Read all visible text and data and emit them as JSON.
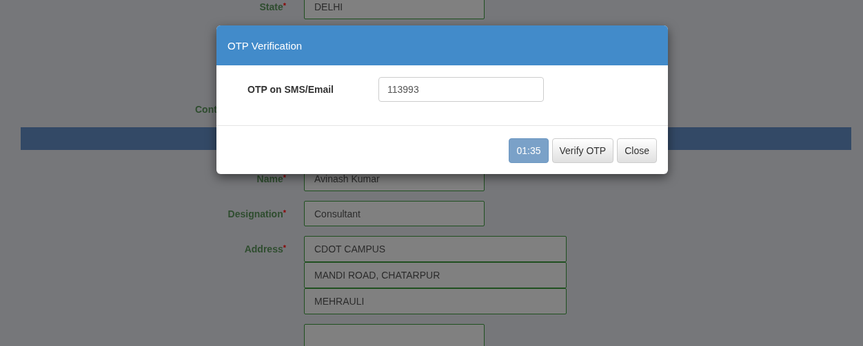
{
  "form": {
    "rows": [
      {
        "kind": "field",
        "label": "State",
        "mark": "*",
        "values": [
          "DELHI"
        ]
      },
      {
        "kind": "cut-label",
        "label": "Cont"
      },
      {
        "kind": "bar"
      },
      {
        "kind": "field",
        "label": "Name",
        "mark": "*",
        "values": [
          "Avinash Kumar"
        ]
      },
      {
        "kind": "field",
        "label": "Designation",
        "mark": "*",
        "values": [
          "Consultant"
        ]
      },
      {
        "kind": "address",
        "label": "Address",
        "mark": "*",
        "values": [
          "CDOT CAMPUS",
          "MANDI ROAD, CHATARPUR",
          "MEHRAULI"
        ]
      },
      {
        "kind": "empty-field"
      }
    ]
  },
  "modal": {
    "title": "OTP Verification",
    "label": "OTP on SMS/Email",
    "value": "113993",
    "timer": "01:35",
    "buttons": [
      "Verify OTP",
      "Close"
    ]
  }
}
